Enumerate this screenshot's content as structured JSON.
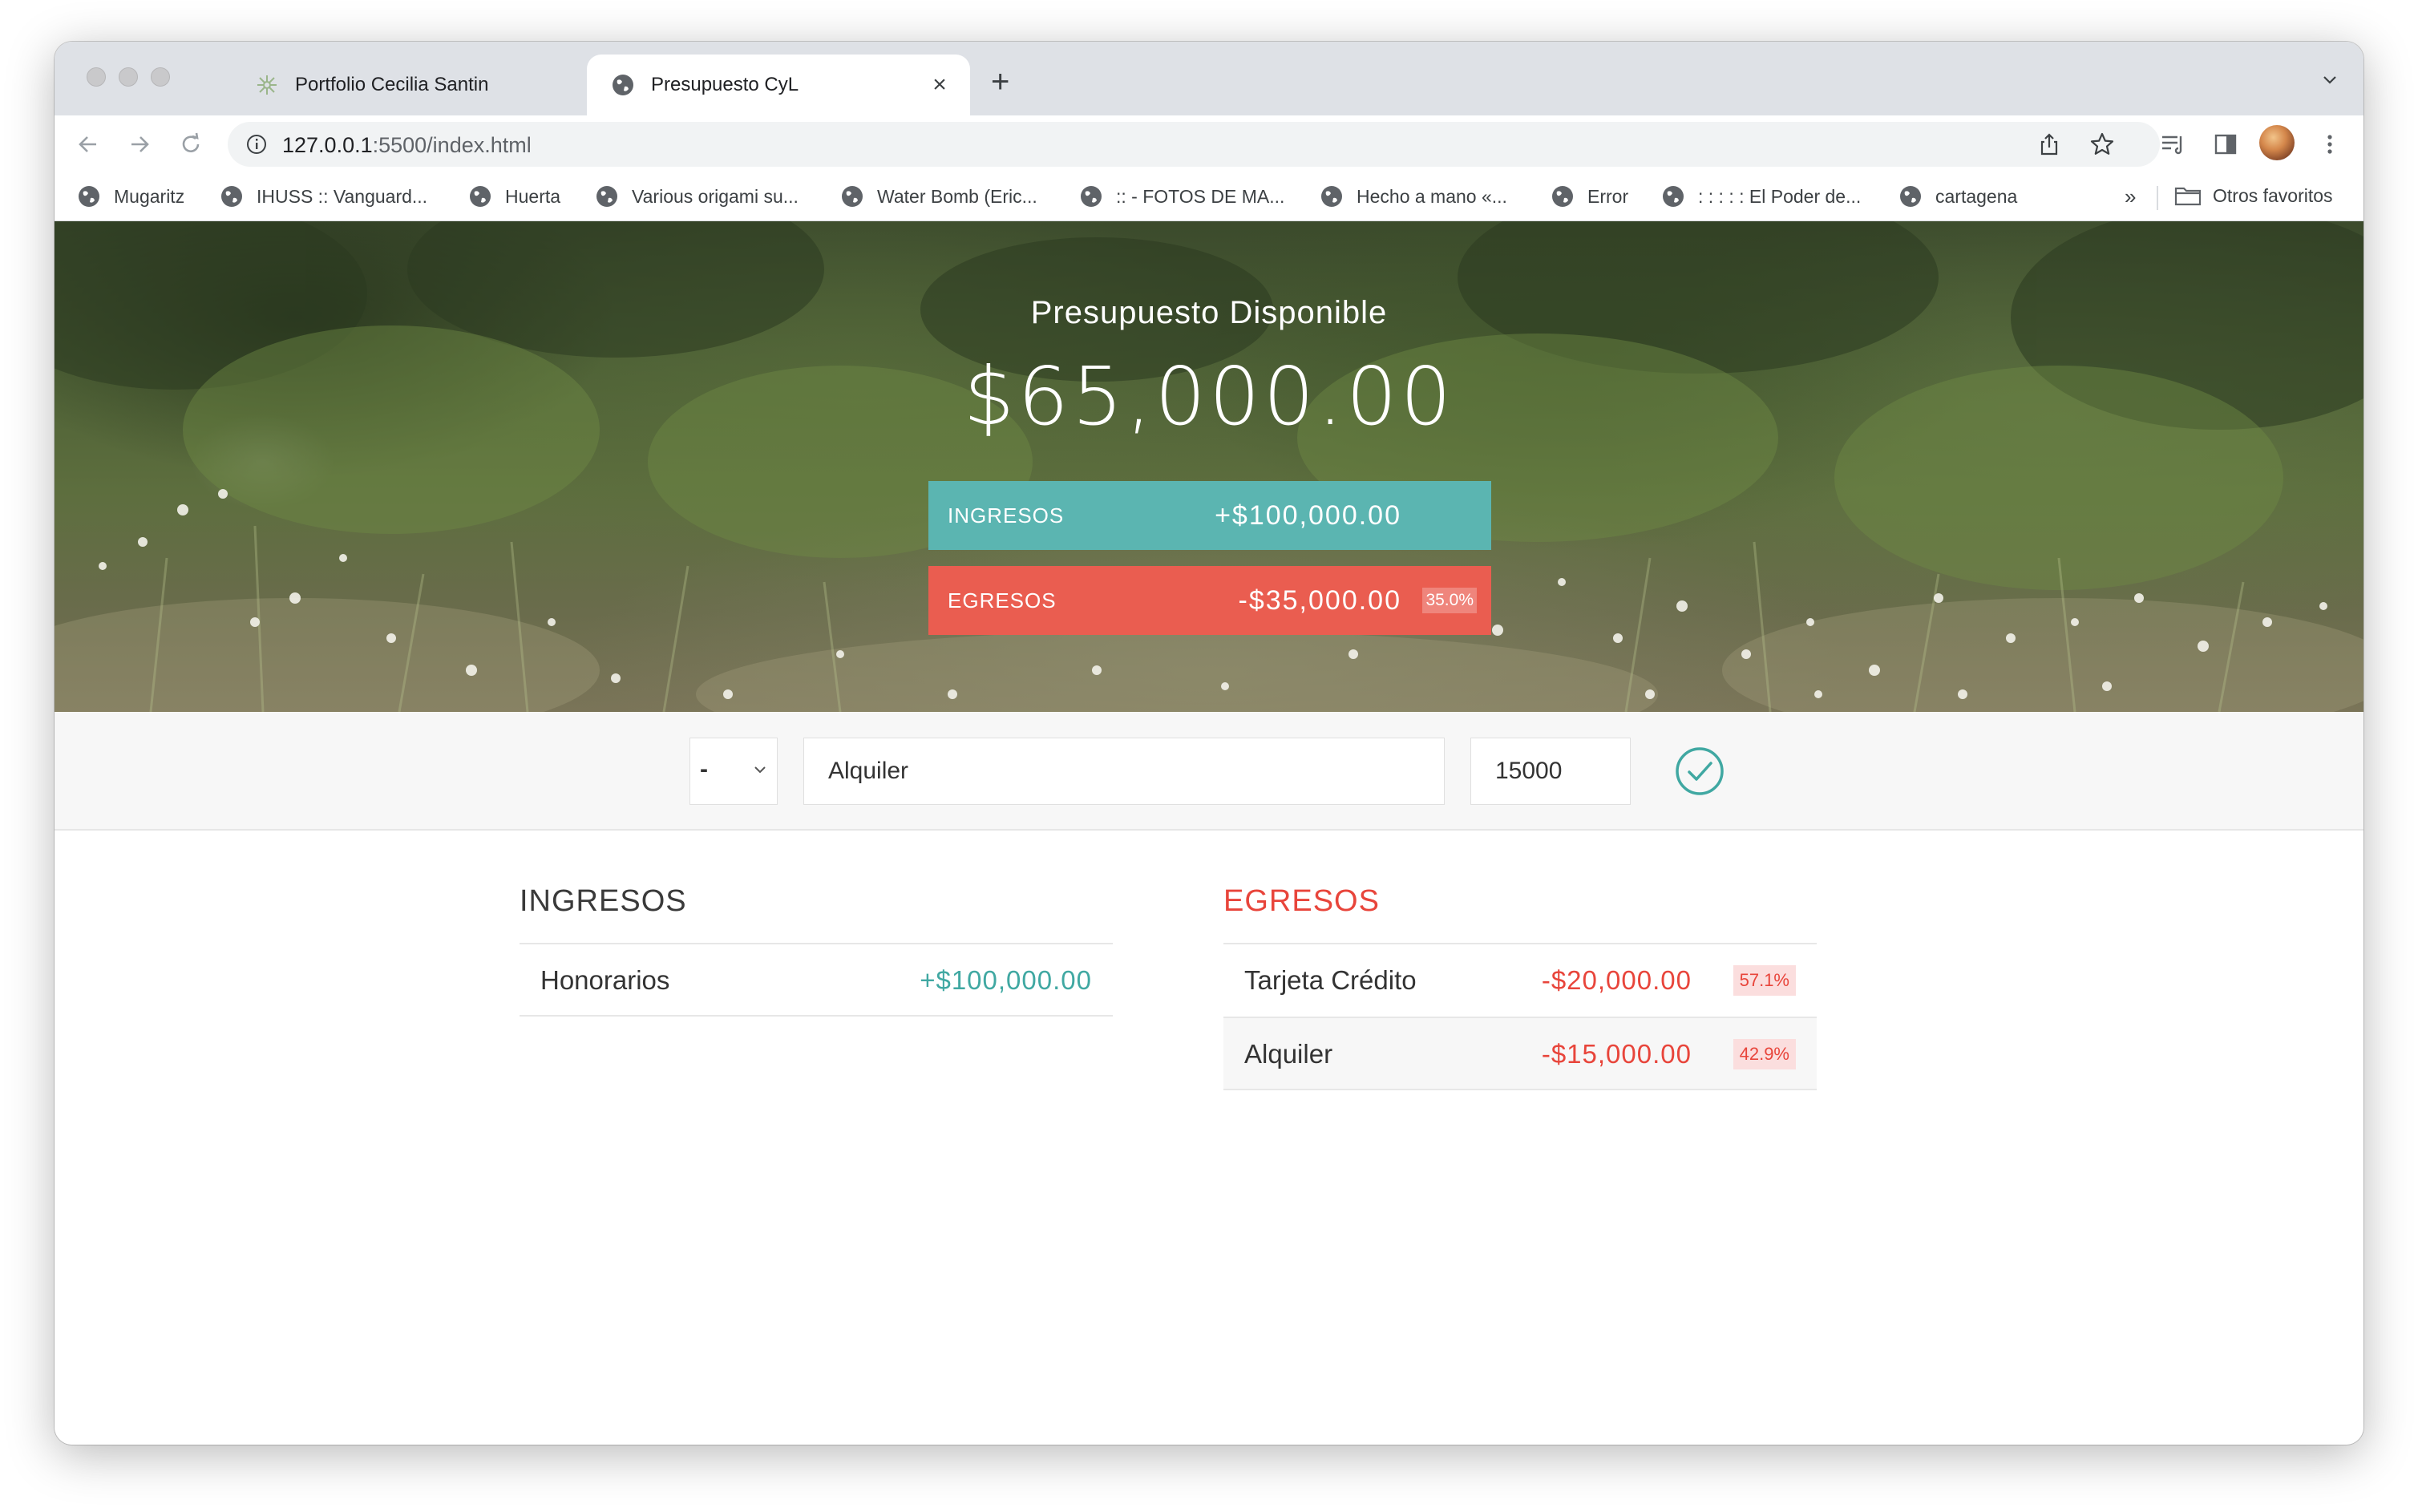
{
  "browser": {
    "tabs": [
      {
        "title": "Portfolio Cecilia Santin",
        "active": false,
        "icon": "leaf-icon"
      },
      {
        "title": "Presupuesto CyL",
        "active": true,
        "icon": "globe-icon"
      }
    ],
    "url_host": "127.0.0.1",
    "url_rest": ":5500/index.html",
    "bookmarks": [
      "Mugaritz",
      "IHUSS :: Vanguard...",
      "Huerta",
      "Various origami su...",
      "Water Bomb (Eric...",
      ":: - FOTOS DE MA...",
      "Hecho a mano «...",
      "Error",
      ": : : : : El Poder de...",
      "cartagena"
    ],
    "bookmarks_more": "»",
    "other_bookmarks": "Otros favoritos"
  },
  "hero": {
    "title": "Presupuesto Disponible",
    "available": "$65,000.00",
    "income_label": "INGRESOS",
    "income_total": "+$100,000.00",
    "expense_label": "EGRESOS",
    "expense_total": "-$35,000.00",
    "expense_pct": "35.0%"
  },
  "form": {
    "type": "-",
    "description": "Alquiler",
    "value": "15000"
  },
  "income": {
    "title": "INGRESOS",
    "items": [
      {
        "description": "Honorarios",
        "value": "+$100,000.00"
      }
    ]
  },
  "expenses": {
    "title": "EGRESOS",
    "items": [
      {
        "description": "Tarjeta Crédito",
        "value": "-$20,000.00",
        "pct": "57.1%"
      },
      {
        "description": "Alquiler",
        "value": "-$15,000.00",
        "pct": "42.9%"
      }
    ]
  },
  "colors": {
    "income": "#5bb5b1",
    "expense": "#ea5d50",
    "income_text": "#40a8a2",
    "expense_text": "#e8453b"
  }
}
